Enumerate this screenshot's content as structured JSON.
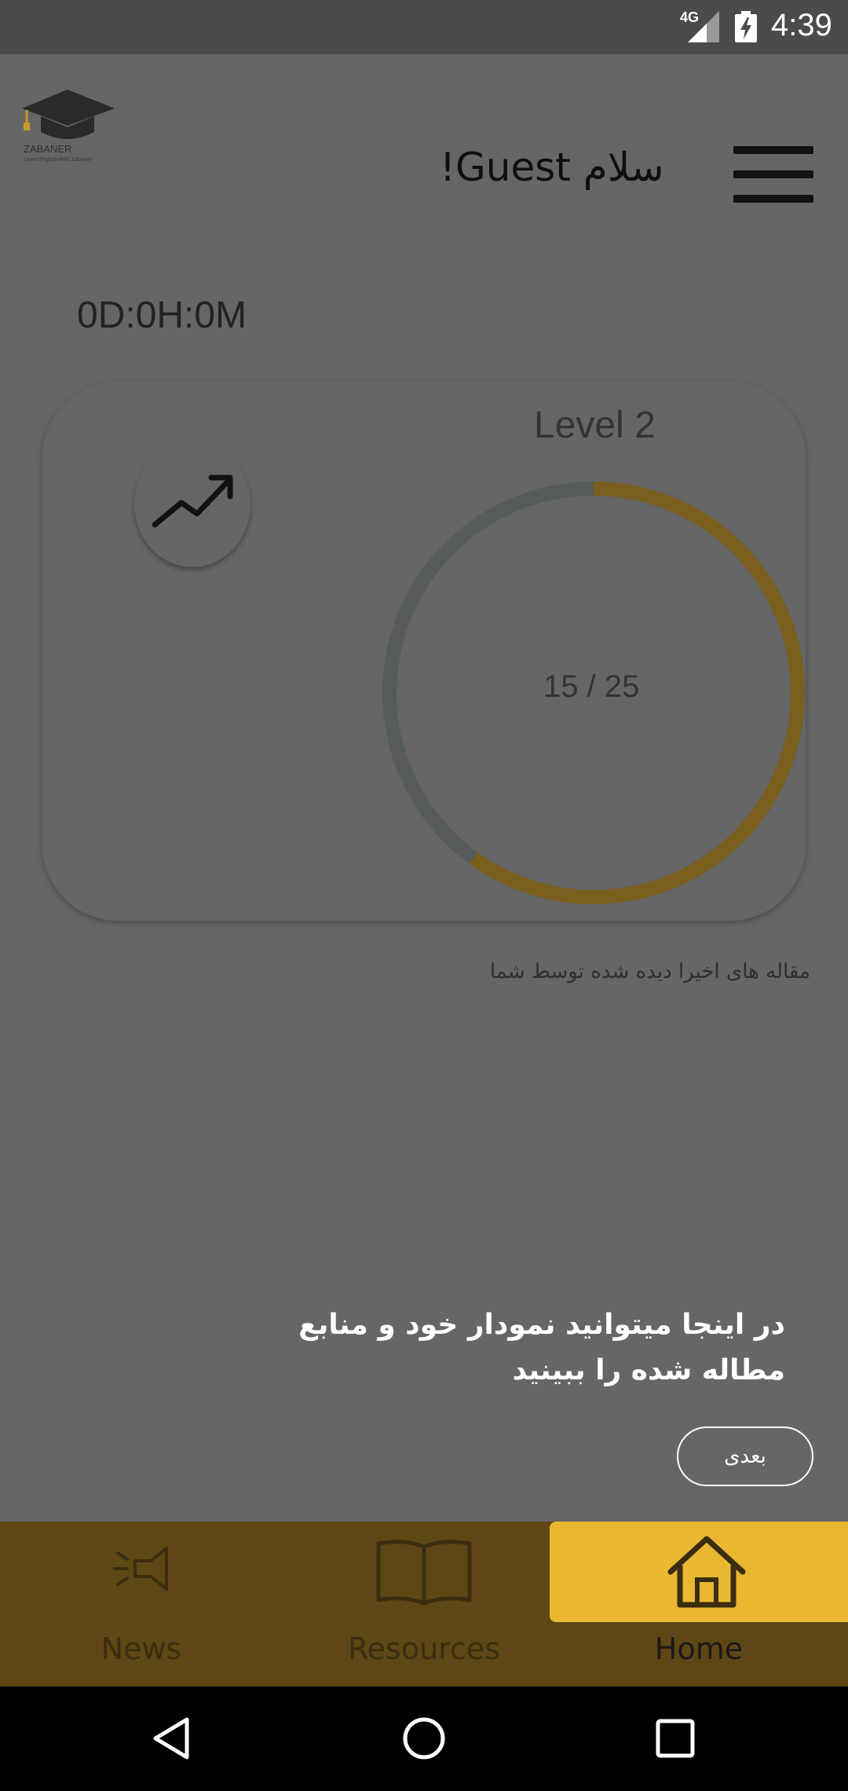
{
  "status_bar": {
    "network": "4G",
    "time": "4:39"
  },
  "header": {
    "logo_name": "ZABANER",
    "logo_tagline": "Learn English With Zabaner",
    "greeting": "سلام Guest!",
    "menu_icon": "hamburger-menu-icon"
  },
  "timer": "0D:0H:0M",
  "progress_card": {
    "trend_icon": "trending-up-icon",
    "level_label": "Level 2",
    "progress_text": "15 / 25",
    "progress_fraction": 0.6,
    "colors": {
      "progress": "#7a5f1e",
      "track": "#565b5c"
    }
  },
  "recent_articles_label": "مقاله های اخیرا دیده شده توسط شما",
  "hint": {
    "text": "در اینجا میتوانید نمودار خود و منابع مطاله شده را ببینید",
    "next_button": "بعدی"
  },
  "bottom_nav": {
    "active": "home",
    "items": [
      {
        "key": "news",
        "label": "News",
        "icon": "megaphone-icon"
      },
      {
        "key": "resources",
        "label": "Resources",
        "icon": "open-book-icon"
      },
      {
        "key": "home",
        "label": "Home",
        "icon": "house-icon"
      }
    ],
    "colors": {
      "bar": "#5e4715",
      "active_highlight": "#eab732"
    }
  },
  "system_nav": [
    "back",
    "home",
    "recents"
  ]
}
